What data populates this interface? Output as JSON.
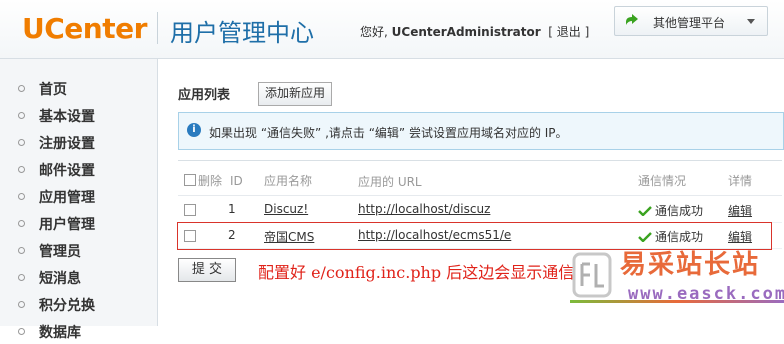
{
  "header": {
    "logo": "UCenter",
    "subtitle": "用户管理中心",
    "greeting_prefix": "您好,",
    "username": "UCenterAdministrator",
    "logout_label": "[ 退出 ]",
    "platform_label": "其他管理平台"
  },
  "sidebar": {
    "items": [
      {
        "label": "首页"
      },
      {
        "label": "基本设置"
      },
      {
        "label": "注册设置"
      },
      {
        "label": "邮件设置"
      },
      {
        "label": "应用管理"
      },
      {
        "label": "用户管理"
      },
      {
        "label": "管理员"
      },
      {
        "label": "短消息"
      },
      {
        "label": "积分兑换"
      },
      {
        "label": "数据库"
      }
    ]
  },
  "main": {
    "title": "应用列表",
    "add_button": "添加新应用",
    "notice": "如果出现 “通信失败” ,请点击 “编辑” 尝试设置应用域名对应的 IP。",
    "table": {
      "headers": {
        "delete": "删除",
        "id": "ID",
        "name": "应用名称",
        "url": "应用的 URL",
        "status": "通信情况",
        "detail": "详情"
      },
      "rows": [
        {
          "id": "1",
          "name": "Discuz!",
          "url": "http://localhost/discuz",
          "status": "通信成功",
          "detail": "编辑"
        },
        {
          "id": "2",
          "name": "帝国CMS",
          "url": "http://localhost/ecms51/e",
          "status": "通信成功",
          "detail": "编辑"
        }
      ]
    },
    "submit_button": "提 交",
    "annotation": "配置好 e/config.inc.php 后这边会显示通信"
  },
  "watermark": {
    "text": "易采站长站",
    "url": "www.easck.com"
  },
  "colors": {
    "brand_orange": "#f07d00",
    "brand_blue": "#1f6fa8",
    "link": "#1b4c82",
    "success": "#3aa320",
    "annotation_red": "#e0231a"
  }
}
